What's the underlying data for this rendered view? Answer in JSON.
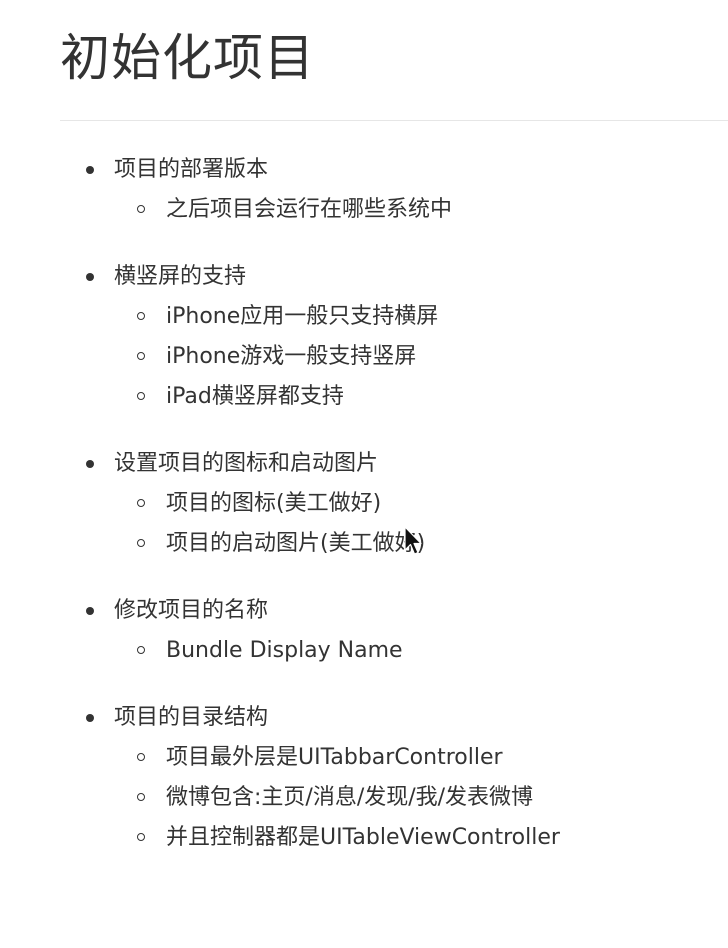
{
  "page": {
    "title": "初始化项目"
  },
  "outline": [
    {
      "label": "项目的部署版本",
      "children": [
        "之后项目会运行在哪些系统中"
      ]
    },
    {
      "label": "横竖屏的支持",
      "children": [
        "iPhone应用一般只支持横屏",
        "iPhone游戏一般支持竖屏",
        "iPad横竖屏都支持"
      ]
    },
    {
      "label": "设置项目的图标和启动图片",
      "children": [
        "项目的图标(美工做好)",
        "项目的启动图片(美工做好)"
      ]
    },
    {
      "label": "修改项目的名称",
      "children": [
        "Bundle Display Name"
      ]
    },
    {
      "label": "项目的目录结构",
      "children": [
        "项目最外层是UITabbarController",
        "微博包含:主页/消息/发现/我/发表微博",
        "并且控制器都是UITableViewController"
      ]
    }
  ],
  "icons": {
    "cursor": "mouse-pointer-icon",
    "disc_bullet": "disc-bullet-icon",
    "circle_bullet": "circle-bullet-icon"
  },
  "colors": {
    "text": "#333333",
    "rule": "#e6e6e6",
    "background": "#ffffff"
  }
}
